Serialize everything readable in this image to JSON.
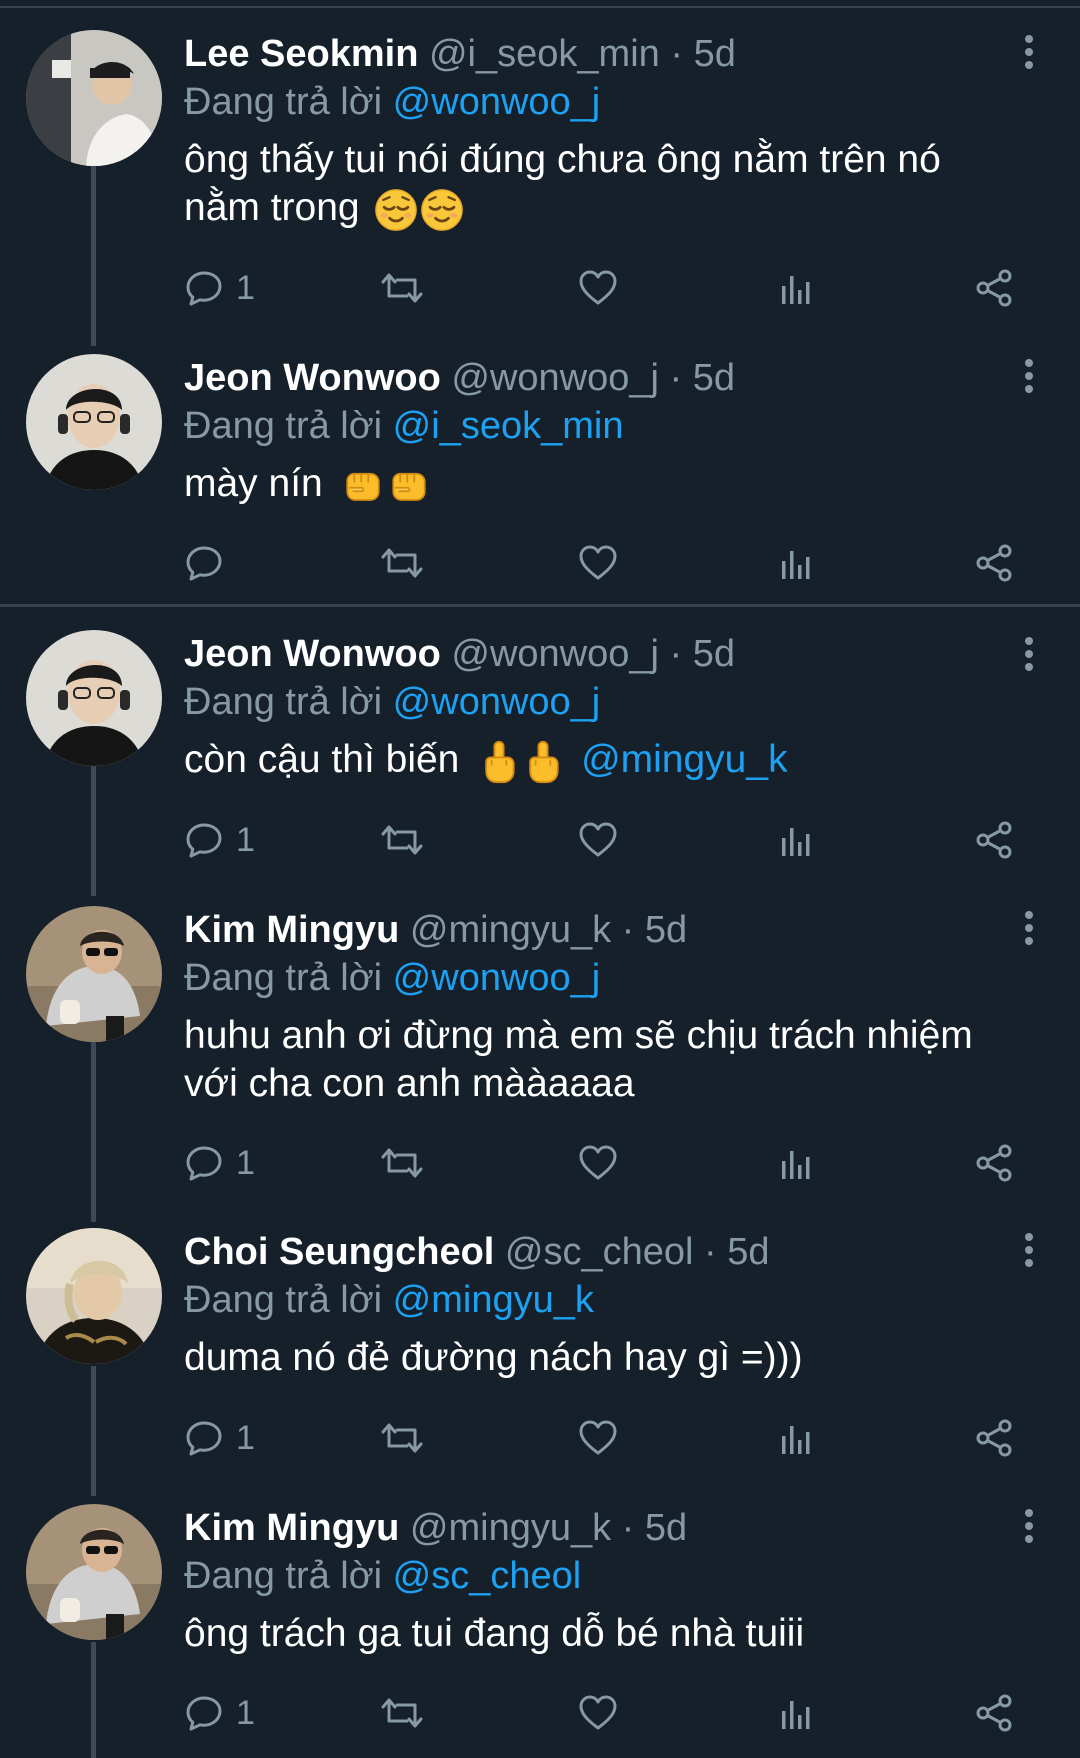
{
  "replying_prefix": "Đang trả lời",
  "tweets": [
    {
      "name": "Lee Seokmin",
      "handle": "@i_seok_min",
      "dot": "·",
      "time": "5d",
      "reply_to": "@wonwoo_j",
      "text_1": "ông thấy tui nói đúng chưa ông nằm trên nó",
      "text_2": "nằm trong",
      "emojis": [
        "relieved-face",
        "relieved-face"
      ],
      "reply_count": "1"
    },
    {
      "name": "Jeon Wonwoo",
      "handle": "@wonwoo_j",
      "dot": "·",
      "time": "5d",
      "reply_to": "@i_seok_min",
      "text_1": "mày nín",
      "emojis": [
        "oncoming-fist",
        "oncoming-fist"
      ],
      "reply_count": ""
    },
    {
      "name": "Jeon Wonwoo",
      "handle": "@wonwoo_j",
      "dot": "·",
      "time": "5d",
      "reply_to": "@wonwoo_j",
      "text_1": "còn cậu thì biến",
      "emojis": [
        "middle-finger",
        "middle-finger"
      ],
      "trailing_mention": "@mingyu_k",
      "reply_count": "1"
    },
    {
      "name": "Kim Mingyu",
      "handle": "@mingyu_k",
      "dot": "·",
      "time": "5d",
      "reply_to": "@wonwoo_j",
      "text_1": "huhu anh ơi đừng mà em sẽ chịu trách nhiệm",
      "text_2": "với cha con anh mààaaaa",
      "reply_count": "1"
    },
    {
      "name": "Choi Seungcheol",
      "handle": "@sc_cheol",
      "dot": "·",
      "time": "5d",
      "reply_to": "@mingyu_k",
      "text_1": "duma nó đẻ đường nách hay gì =)))",
      "reply_count": "1"
    },
    {
      "name": "Kim Mingyu",
      "handle": "@mingyu_k",
      "dot": "·",
      "time": "5d",
      "reply_to": "@sc_cheol",
      "text_1": "ông trách ga tui đang dỗ bé nhà tuiii",
      "reply_count": "1"
    }
  ],
  "icons": {
    "reply": "reply-icon",
    "retweet": "retweet-icon",
    "like": "heart-icon",
    "analytics": "analytics-icon",
    "share": "share-icon",
    "more": "more-vertical-icon"
  },
  "colors": {
    "background": "#15202b",
    "text": "#ffffff",
    "secondary": "#8899a6",
    "link": "#1da1f2",
    "divider": "#38444d"
  }
}
